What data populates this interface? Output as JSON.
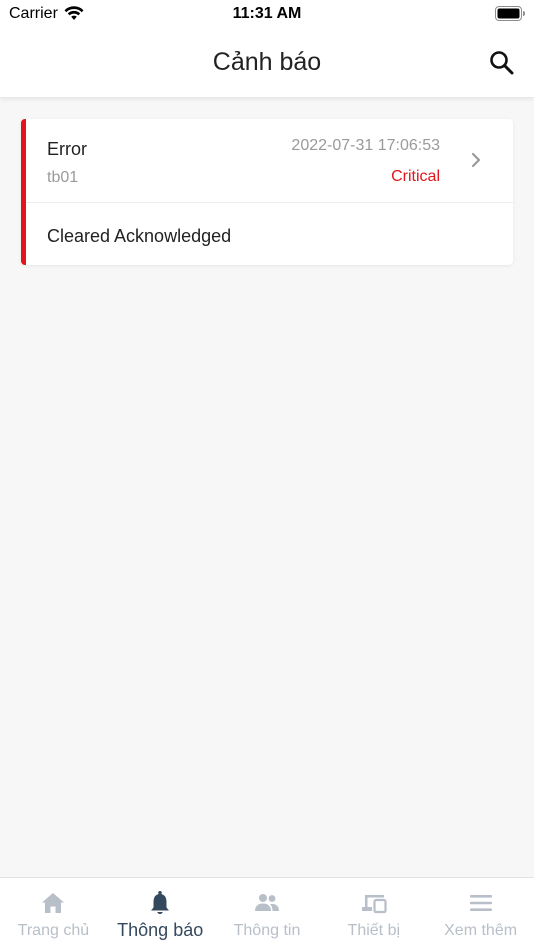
{
  "status_bar": {
    "carrier": "Carrier",
    "time": "11:31 AM"
  },
  "header": {
    "title": "Cảnh báo",
    "search_icon": "search-icon"
  },
  "alarms": [
    {
      "type": "Error",
      "device": "tb01",
      "time": "2022-07-31 17:06:53",
      "severity": "Critical",
      "status": "Cleared Acknowledged",
      "accent_color": "#e3141c",
      "severity_color": "#e3141c"
    }
  ],
  "tabbar": {
    "tabs": [
      {
        "label": "Trang chủ",
        "icon": "home-icon"
      },
      {
        "label": "Thông báo",
        "icon": "bell-icon",
        "active": true
      },
      {
        "label": "Thông tin",
        "icon": "people-icon"
      },
      {
        "label": "Thiết bị",
        "icon": "devices-icon"
      },
      {
        "label": "Xem thêm",
        "icon": "menu-icon"
      }
    ],
    "active_color": "#34495e",
    "inactive_color": "#b8bfc9"
  }
}
